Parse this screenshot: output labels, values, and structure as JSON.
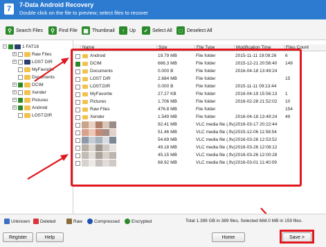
{
  "titlebar": {
    "app_title": "7-Data Android Recovery",
    "subtitle": "Double click on the file to preview; select files to recover",
    "logo_glyph": "7"
  },
  "toolbar": {
    "search_files": "Search Files",
    "find_file": "Find File",
    "thumbnail": "Thumbnail",
    "up": "Up",
    "select_all": "Select All",
    "deselect_all": "Deselect All"
  },
  "tree": {
    "root": "1 FAT16",
    "items": [
      "Raw Files",
      "LOST DIR",
      "MyFavorite",
      "Documents",
      "DCIM",
      "Xender",
      "Pictures",
      "Android",
      "LOST.DIR"
    ]
  },
  "columns": {
    "name": "Name",
    "size": "Size",
    "type": "File Type",
    "mtime": "Modification Time",
    "count": "Files Count"
  },
  "rows": [
    {
      "name": "Android",
      "size": "19.79 MB",
      "type": "File folder",
      "mtime": "2015-11-11 19:08:26",
      "count": "6"
    },
    {
      "name": "DCIM",
      "size": "666.3 MB",
      "type": "File folder",
      "mtime": "2015-12-21 20:56:40",
      "count": "149"
    },
    {
      "name": "Documents",
      "size": "0.000 B",
      "type": "File folder",
      "mtime": "2016-04-18 13:49:24",
      "count": ""
    },
    {
      "name": "LOST DIR",
      "size": "2.684 MB",
      "type": "File folder",
      "mtime": "",
      "count": "15"
    },
    {
      "name": "LOST.DIR",
      "size": "0.000 B",
      "type": "File folder",
      "mtime": "2015-11-11 09:13:44",
      "count": ""
    },
    {
      "name": "MyFavorite",
      "size": "27.27 KB",
      "type": "File folder",
      "mtime": "2016-04-19 15:56:13",
      "count": "1"
    },
    {
      "name": "Pictures",
      "size": "1.706 MB",
      "type": "File folder",
      "mtime": "2016-02-28 21:52:02",
      "count": "10"
    },
    {
      "name": "Raw Files",
      "size": "476.8 MB",
      "type": "File folder",
      "mtime": "",
      "count": "154"
    },
    {
      "name": "Xender",
      "size": "1.549 MB",
      "type": "File folder",
      "mtime": "2016-04-18 13:49:24",
      "count": "49"
    },
    {
      "name": "",
      "size": "92.41 MB",
      "type": "VLC media file (.flv)",
      "mtime": "2016-03-17 20:22:44",
      "count": ""
    },
    {
      "name": "",
      "size": "51.46 MB",
      "type": "VLC media file (.flv)",
      "mtime": "2015-12-06 11:58:54",
      "count": ""
    },
    {
      "name": "",
      "size": "54.69 MB",
      "type": "VLC media file (.flv)",
      "mtime": "2016-03-26 12:53:52",
      "count": ""
    },
    {
      "name": "",
      "size": "49.18 MB",
      "type": "VLC media file (.flv)",
      "mtime": "2016-03-26 12:08:12",
      "count": ""
    },
    {
      "name": "",
      "size": "45.15 MB",
      "type": "VLC media file (.flv)",
      "mtime": "2016-03-26 12:00:28",
      "count": ""
    },
    {
      "name": "",
      "size": "68.92 MB",
      "type": "VLC media file (.flv)",
      "mtime": "2016-03-01 11:40:09",
      "count": ""
    }
  ],
  "legend": {
    "unknown": "Unknown",
    "deleted": "Deleted",
    "raw": "Raw",
    "compressed": "Compressed",
    "encrypted": "Encrypted"
  },
  "status": "Total 1.399 GB in 389 files, Selected 668.0 MB in 159 files.",
  "buttons": {
    "register": "Register",
    "help": "Help",
    "home": "Home",
    "save": "Save >"
  },
  "colors": {
    "title_bar": "#2d7bd0",
    "annotation": "#e0171e",
    "checked": "#2a8a2a",
    "folder": "#f2c14e"
  }
}
